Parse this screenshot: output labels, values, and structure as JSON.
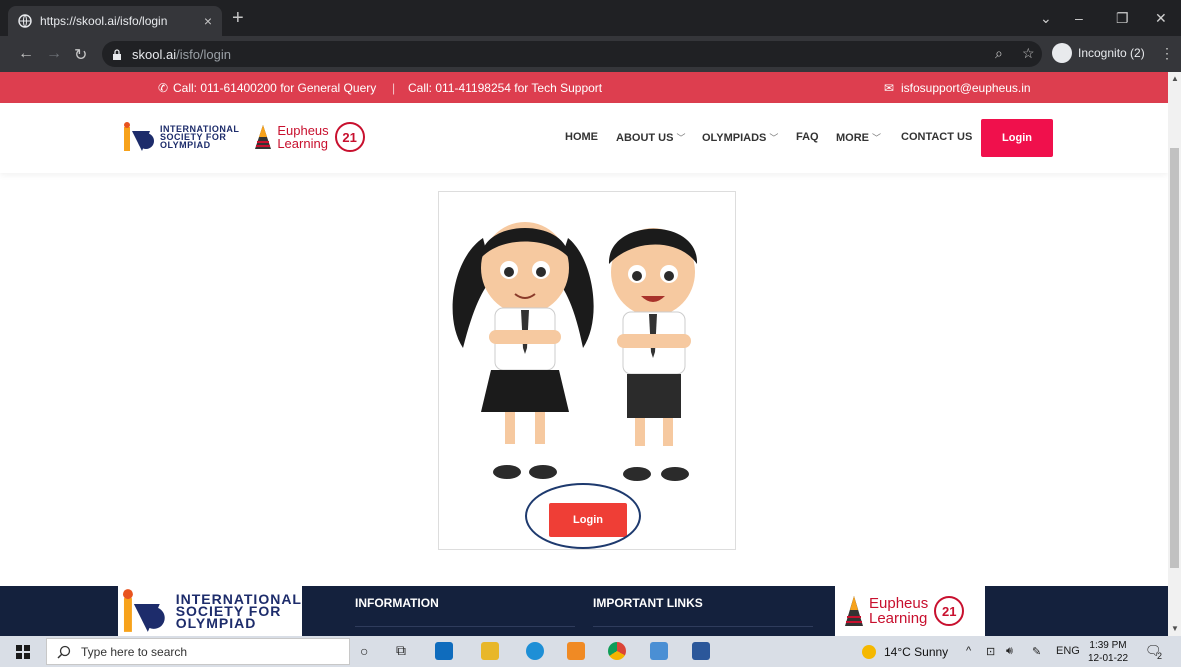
{
  "browser": {
    "tab_title": "https://skool.ai/isfo/login",
    "tab_close": "×",
    "new_tab": "+",
    "url_host": "skool.ai",
    "url_path": "/isfo/login",
    "incognito_label": "Incognito (2)"
  },
  "topbar": {
    "general_query": "Call: 011-61400200 for General Query",
    "separator": "|",
    "tech_support": "Call: 011-41198254 for Tech Support",
    "email": "isfosupport@eupheus.in"
  },
  "header": {
    "isfo_logo_lines": [
      "INTERNATIONAL",
      "SOCIETY FOR",
      "OLYMPIAD"
    ],
    "eupheus_logo_lines": [
      "Eupheus",
      "Learning"
    ],
    "badge": "21",
    "nav": [
      {
        "label": "HOME",
        "has_dropdown": false
      },
      {
        "label": "ABOUT US",
        "has_dropdown": true
      },
      {
        "label": "OLYMPIADS",
        "has_dropdown": true
      },
      {
        "label": "FAQ",
        "has_dropdown": false
      },
      {
        "label": "MORE",
        "has_dropdown": true
      },
      {
        "label": "CONTACT US",
        "has_dropdown": false
      }
    ],
    "login_label": "Login"
  },
  "main": {
    "login_label": "Login"
  },
  "footer": {
    "isfo_logo_lines": [
      "INTERNATIONAL",
      "SOCIETY FOR",
      "OLYMPIAD"
    ],
    "information_heading": "INFORMATION",
    "important_links_heading": "IMPORTANT LINKS",
    "eupheus_logo_lines": [
      "Eupheus",
      "Learning"
    ],
    "badge": "21"
  },
  "taskbar": {
    "search_placeholder": "Type here to search",
    "weather": "14°C  Sunny",
    "language": "ENG",
    "time": "1:39 PM",
    "date": "12-01-22",
    "notification_count": "2"
  },
  "colors": {
    "topbar_red": "#dd3e4f",
    "login_pink": "#f0104c",
    "login_red": "#ef3e36",
    "footer_navy": "#14213d",
    "highlight_circle": "#1e3a6e"
  }
}
